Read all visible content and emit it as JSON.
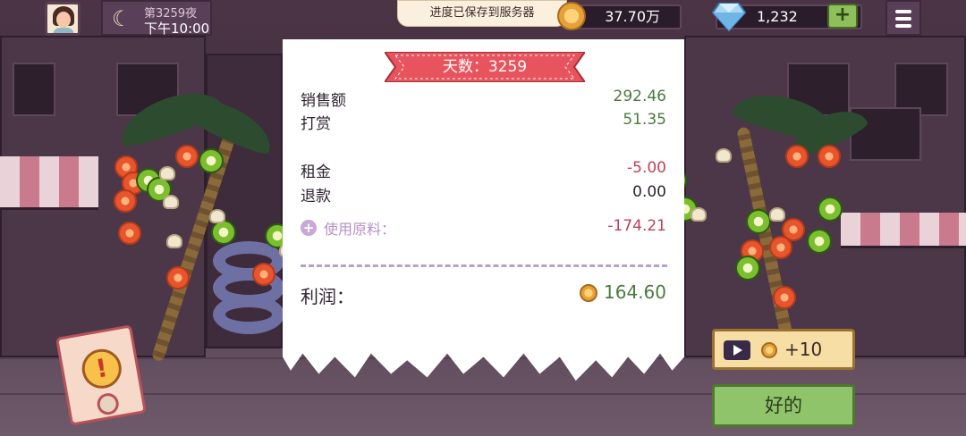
{
  "topbar": {
    "night_label": "第3259夜",
    "clock": "下午10:00",
    "toast": "进度已保存到服务器",
    "coins": "37.70万",
    "gems": "1,232",
    "plus_label": "+"
  },
  "receipt": {
    "day_title": "天数：3259",
    "sales_label": "销售额",
    "sales_value": "292.46",
    "tips_label": "打赏",
    "tips_value": "51.35",
    "rent_label": "租金",
    "rent_value": "-5.00",
    "refund_label": "退款",
    "refund_value": "0.00",
    "ingredients_label": "使用原料：",
    "ingredients_value": "-174.21",
    "profit_label": "利润：",
    "profit_value": "164.60"
  },
  "actions": {
    "ad_reward": "+10",
    "ok_label": "好的",
    "alert_mark": "!"
  },
  "colors": {
    "positive": "#4a7a3e",
    "negative": "#c0405a",
    "ribbon": "#e8545e",
    "ok_button": "#8fc46a"
  }
}
